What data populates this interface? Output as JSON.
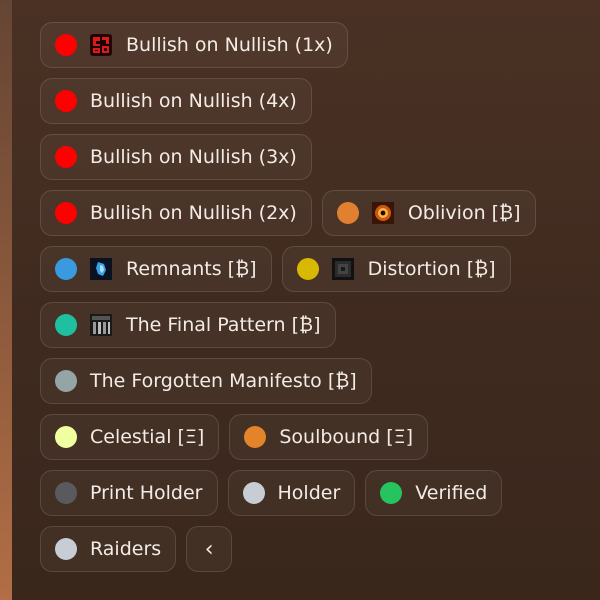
{
  "chips": [
    {
      "key": "bullish-1x",
      "label": "Bullish on Nullish (1x)",
      "color": "#ff0000",
      "thumb": "red-glyph"
    },
    {
      "key": "bullish-4x",
      "label": "Bullish on Nullish (4x)",
      "color": "#ff0000"
    },
    {
      "key": "bullish-3x",
      "label": "Bullish on Nullish (3x)",
      "color": "#ff0000"
    },
    {
      "key": "bullish-2x",
      "label": "Bullish on Nullish (2x)",
      "color": "#ff0000"
    },
    {
      "key": "oblivion",
      "label": "Oblivion [₿]",
      "color": "#e08030",
      "thumb": "orange-burst"
    },
    {
      "key": "remnants",
      "label": "Remnants [₿]",
      "color": "#3a9ae0",
      "thumb": "blue-crystal"
    },
    {
      "key": "distortion",
      "label": "Distortion [₿]",
      "color": "#d8b800",
      "thumb": "dark-square"
    },
    {
      "key": "final-pattern",
      "label": "The Final Pattern [₿]",
      "color": "#1fbfa0",
      "thumb": "grid-panel"
    },
    {
      "key": "forgotten-manifesto",
      "label": "The Forgotten Manifesto [₿]",
      "color": "#95a5a6"
    },
    {
      "key": "celestial",
      "label": "Celestial [Ξ]",
      "color": "#f0ffa0"
    },
    {
      "key": "soulbound",
      "label": "Soulbound [Ξ]",
      "color": "#e3832a"
    },
    {
      "key": "print-holder",
      "label": "Print Holder",
      "color": "#5a5a5e"
    },
    {
      "key": "holder",
      "label": "Holder",
      "color": "#c8ccd4"
    },
    {
      "key": "verified",
      "label": "Verified",
      "color": "#25c45e"
    },
    {
      "key": "raiders",
      "label": "Raiders",
      "color": "#c8ccd4"
    }
  ],
  "collapse": {
    "glyph": "‹",
    "icon": "chevron-left-icon"
  }
}
